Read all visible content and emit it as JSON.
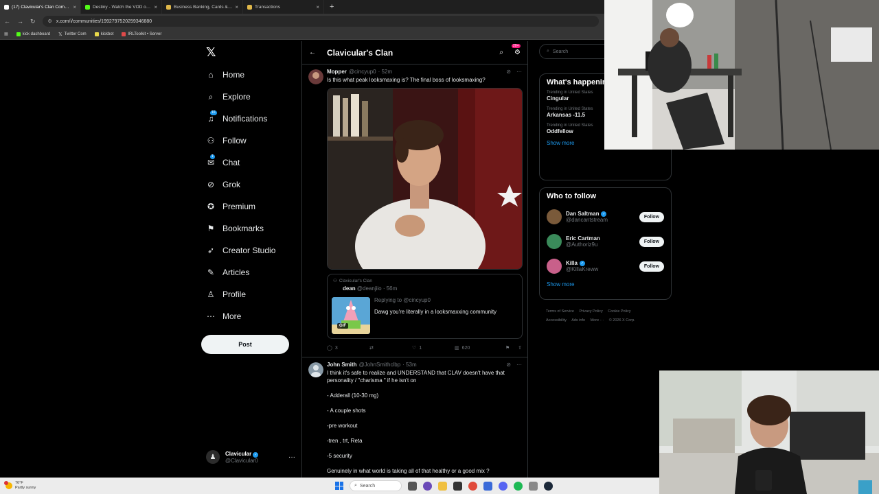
{
  "browser": {
    "tabs": [
      {
        "label": "(17) Clavicular's Clan Communi",
        "color": "#ffffff",
        "active": true
      },
      {
        "label": "Destiny - Watch the VOD on Ki",
        "color": "#53fc18",
        "active": false
      },
      {
        "label": "Business Banking, Cards & Trea",
        "color": "#e0b84a",
        "active": false
      },
      {
        "label": "Transactions",
        "color": "#e0b84a",
        "active": false
      }
    ],
    "url": "x.com/i/communities/1992797520259346880",
    "bookmarks": [
      "kick dashboard",
      "Twitter Com",
      "kickbot",
      "IRLToolkit • Server"
    ]
  },
  "nav": {
    "items": [
      {
        "label": "Home",
        "icon": "home-icon",
        "glyph": "⌂"
      },
      {
        "label": "Explore",
        "icon": "search-icon",
        "glyph": "⌕"
      },
      {
        "label": "Notifications",
        "icon": "bell-icon",
        "glyph": "♫",
        "badge": "16"
      },
      {
        "label": "Follow",
        "icon": "follow-icon",
        "glyph": "⚇"
      },
      {
        "label": "Chat",
        "icon": "chat-icon",
        "glyph": "✉",
        "badge": "1"
      },
      {
        "label": "Grok",
        "icon": "grok-icon",
        "glyph": "⊘"
      },
      {
        "label": "Premium",
        "icon": "premium-icon",
        "glyph": "✪"
      },
      {
        "label": "Bookmarks",
        "icon": "bookmark-icon",
        "glyph": "⚑"
      },
      {
        "label": "Creator Studio",
        "icon": "rocket-icon",
        "glyph": "➶"
      },
      {
        "label": "Articles",
        "icon": "articles-icon",
        "glyph": "✎"
      },
      {
        "label": "Profile",
        "icon": "profile-icon",
        "glyph": "♙"
      },
      {
        "label": "More",
        "icon": "more-icon",
        "glyph": "⋯"
      }
    ],
    "post_label": "Post",
    "account": {
      "name": "Clavicular",
      "handle": "@Clavicular0"
    }
  },
  "community": {
    "title": "Clavicular's Clan",
    "badge": "20+"
  },
  "tweet1": {
    "name": "Mopper",
    "handle": "@cincyup0",
    "time": "· 52m",
    "text": "Is this what peak looksmaxing is? The final boss of looksmaxing?",
    "quote": {
      "community": "Clavicular's Clan",
      "name": "dean",
      "handle": "@deanjiio",
      "time": "· 56m",
      "replying": "Replying to @cincyup0",
      "text": "Dawg you're literally in a looksmaxxing community",
      "gif_label": "GIF"
    },
    "stats": {
      "replies": "3",
      "retweets": "",
      "likes": "1",
      "views": "620"
    }
  },
  "tweet2": {
    "name": "John Smith",
    "handle": "@JohnSmithclbp",
    "time": "· 53m",
    "lines": [
      "I think it's safe to realize and UNDERSTAND that CLAV doesn't have that personality / \"charisma \" if he isn't  on",
      "- Adderall (10-30 mg)",
      "- A couple shots",
      "-pre workout",
      "-tren , trt, Reta",
      "-5 security",
      "Genuinely in what world is taking all of that healthy or a good mix ?"
    ]
  },
  "right": {
    "search_placeholder": "Search",
    "trends_title": "What's happening",
    "trends": [
      {
        "context": "Trending in United States",
        "name": "Cingular"
      },
      {
        "context": "Trending in United States",
        "name": "Arkansas -11.5"
      },
      {
        "context": "Trending in United States",
        "name": "Oddfellow"
      }
    ],
    "show_more": "Show more",
    "wtf_title": "Who to follow",
    "follow_label": "Follow",
    "who_to_follow": [
      {
        "name": "Dan Saltman",
        "handle": "@dancantstream",
        "color": "#7a5a3a"
      },
      {
        "name": "Eric Cartman",
        "handle": "@Authoriz9u",
        "color": "#3a8a5a"
      },
      {
        "name": "Killa",
        "handle": "@KillaKreww",
        "color": "#c8608a"
      }
    ],
    "footer": [
      "Terms of Service",
      "Privacy Policy",
      "Cookie Policy",
      "Accessibility",
      "Ads info",
      "More ···",
      "© 2026 X Corp."
    ]
  },
  "taskbar": {
    "temp": "76°F",
    "weather": "Partly sunny",
    "search_placeholder": "Search"
  }
}
